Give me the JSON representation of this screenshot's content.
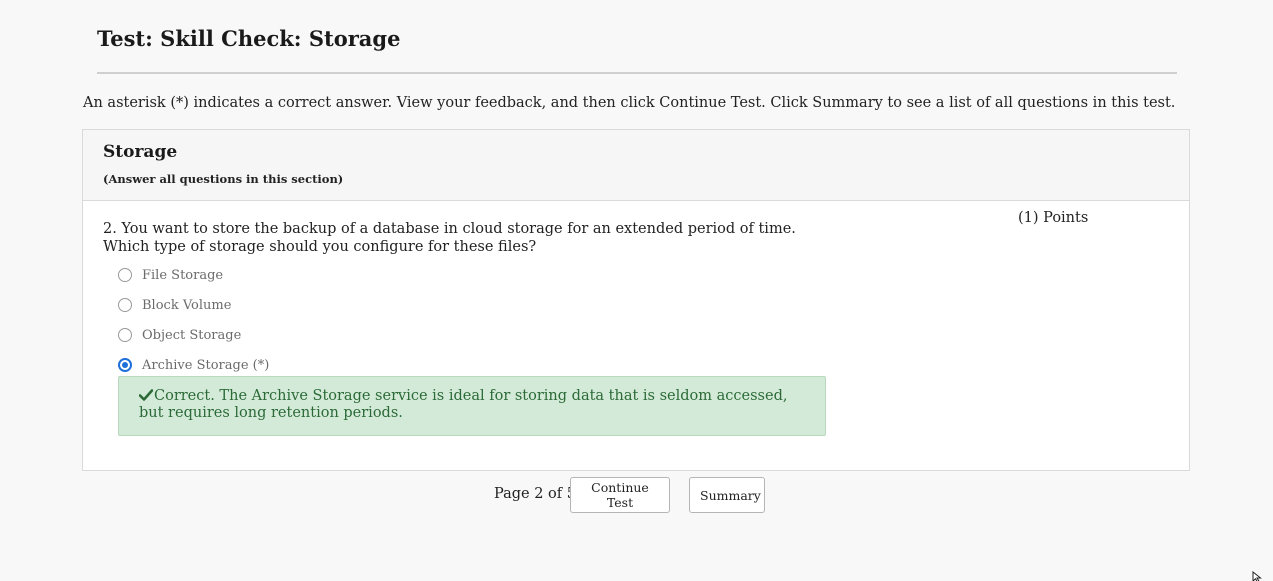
{
  "page_title": "Test: Skill Check: Storage",
  "instructions": "An asterisk (*) indicates a correct answer. View your feedback, and then click Continue Test. Click Summary to see a list of all questions in this test.",
  "section": {
    "title": "Storage",
    "subtitle": "(Answer all questions in this section)"
  },
  "question": {
    "line1": "2. You want to store the backup of a database in cloud storage for an extended period of time.",
    "line2": "Which type of storage should you configure for these files?",
    "points": "(1) Points",
    "options": [
      {
        "label": "File Storage",
        "selected": false
      },
      {
        "label": "Block Volume",
        "selected": false
      },
      {
        "label": "Object Storage",
        "selected": false
      },
      {
        "label": "Archive Storage (*)",
        "selected": true
      }
    ],
    "feedback": "Correct. The Archive Storage service is ideal for storing data that is seldom accessed, but requires long retention periods."
  },
  "footer": {
    "page_indicator": "Page 2 of 5",
    "continue_label": "Continue Test",
    "summary_label": "Summary"
  },
  "colors": {
    "accent": "#1e6fd9",
    "feedback_bg": "#d4ead8",
    "feedback_text": "#2b6a37"
  }
}
